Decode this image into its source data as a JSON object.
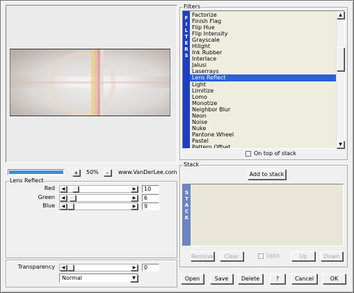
{
  "preview": {
    "zoom": "50%",
    "zoom_in": "+",
    "zoom_out": "–",
    "brand": "www.VanDerLee.com"
  },
  "filters": {
    "title": "Filters",
    "side_label": "FILTERS",
    "items": [
      "Factorize",
      "Finish Flag",
      "Flip Hue",
      "Flip Intensity",
      "Grayscale",
      "Hilight",
      "Ink Rubber",
      "Interlace",
      "Jalusi",
      "Laserrays",
      "Lens Reflect",
      "Light",
      "Limitize",
      "Lomo",
      "Monotize",
      "Neighbor Blur",
      "Neon",
      "Noise",
      "Nuke",
      "Pantone Wheel",
      "Pastel",
      "Pattern Offset"
    ],
    "selected_index": 10,
    "on_top_label": "On top of stack",
    "on_top_checked": false
  },
  "stack": {
    "title": "Stack",
    "side_label": "STACK",
    "add_label": "Add to stack",
    "remove_label": "Remove",
    "clear_label": "Clear",
    "upto_label": "Upto",
    "up_label": "Up",
    "down_label": "Down"
  },
  "lens": {
    "title": "Lens Reflect",
    "params": [
      {
        "label": "Red",
        "value": "10",
        "fraction": 0.19
      },
      {
        "label": "Green",
        "value": "6",
        "fraction": 0.13
      },
      {
        "label": "Blue",
        "value": "9",
        "fraction": 0.1
      }
    ]
  },
  "transparency": {
    "label": "Transparency",
    "value": "0",
    "fraction": 0.0,
    "blend_mode": "Normal"
  },
  "buttons": {
    "open": "Open",
    "save": "Save",
    "delete": "Delete",
    "help": "?",
    "cancel": "Cancel",
    "ok": "OK"
  },
  "colors": {
    "accent_blue": "#2a5fd6",
    "panel_beige": "#e9e6d9",
    "stack_blue": "#6a86c7",
    "filters_blue": "#1d3fc4"
  }
}
